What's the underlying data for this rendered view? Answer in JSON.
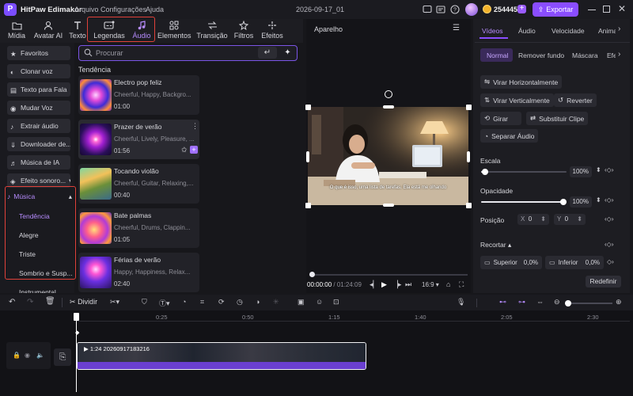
{
  "titlebar": {
    "app_name": "HitPaw Edimakor",
    "menu": [
      "Arquivo",
      "Configurações",
      "Ajuda"
    ],
    "project_name": "2026-09-17_01",
    "credits": "254445",
    "export_label": "Exportar"
  },
  "media_tabs": [
    {
      "label": "Mídia",
      "icon": "folder-icon"
    },
    {
      "label": "Avatar AI",
      "icon": "avatar-icon"
    },
    {
      "label": "Texto",
      "icon": "text-icon"
    },
    {
      "label": "Legendas",
      "icon": "captions-icon"
    },
    {
      "label": "Áudio",
      "icon": "music-note-icon",
      "active": true
    },
    {
      "label": "Elementos",
      "icon": "elements-icon"
    },
    {
      "label": "Transição",
      "icon": "transition-icon"
    },
    {
      "label": "Filtros",
      "icon": "filters-icon"
    },
    {
      "label": "Efeitos",
      "icon": "effects-icon"
    }
  ],
  "left_nav": {
    "items": [
      {
        "label": "Favoritos",
        "icon": "star-icon"
      },
      {
        "label": "Clonar voz",
        "icon": "voice-clone-icon"
      },
      {
        "label": "Texto para Fala",
        "icon": "tts-icon"
      },
      {
        "label": "Mudar Voz",
        "icon": "voice-change-icon"
      },
      {
        "label": "Extrair áudio",
        "icon": "mic-icon"
      },
      {
        "label": "Downloader de...",
        "icon": "download-icon"
      },
      {
        "label": "Música de IA",
        "icon": "ai-music-icon"
      },
      {
        "label": "Efeito sonoro...",
        "icon": "sound-effect-icon"
      }
    ],
    "music_group": {
      "label": "Música",
      "subitems": [
        "Tendência",
        "Alegre",
        "Triste",
        "Sombrio e Susp...",
        "Instrumental"
      ]
    }
  },
  "library": {
    "search_placeholder": "Procurar",
    "section_title": "Tendência",
    "tracks": [
      {
        "title": "Electro pop feliz",
        "tags": "Cheerful, Happy, Backgro...",
        "duration": "01:00"
      },
      {
        "title": "Prazer de verão",
        "tags": "Cheerful, Lively, Pleasure, ...",
        "duration": "01:56"
      },
      {
        "title": "Tocando violão",
        "tags": "Cheerful, Guitar, Relaxing,...",
        "duration": "00:40"
      },
      {
        "title": "Bate palmas",
        "tags": "Cheerful, Drums, Clappin...",
        "duration": "01:05"
      },
      {
        "title": "Férias de verão",
        "tags": "Happy, Happiness, Relax...",
        "duration": "02:40"
      }
    ]
  },
  "player": {
    "title": "Aparelho",
    "subtitle": "O que é isso, uma lista de tarefas. Ela está me olhando",
    "time_current": "00:00:00",
    "time_total": "01:24:09",
    "aspect": "16:9"
  },
  "right_panel": {
    "tabs": [
      "Vídeos",
      "Áudio",
      "Velocidade",
      "Animação"
    ],
    "subtabs": [
      "Normal",
      "Remover fundo",
      "Máscara",
      "Efeito"
    ],
    "buttons": {
      "flip_h": "Virar Horizontalmente",
      "flip_v": "Virar Verticalmente",
      "reverse": "Reverter",
      "rotate": "Girar",
      "replace": "Substituir Clipe",
      "separate_audio": "Separar Áudio"
    },
    "scale": {
      "label": "Escala",
      "value": "100%",
      "level": 0.05
    },
    "opacity": {
      "label": "Opacidade",
      "value": "100%",
      "level": 1.0
    },
    "position": {
      "label": "Posição",
      "x_label": "X",
      "x": "0",
      "y_label": "Y",
      "y": "0"
    },
    "crop": {
      "label": "Recortar",
      "top_label": "Superior",
      "top": "0,0%",
      "bottom_label": "Inferior",
      "bottom": "0,0%"
    },
    "reset_label": "Redefinir"
  },
  "timeline": {
    "split_label": "Dividir",
    "ticks": [
      "0:25",
      "0:50",
      "1:15",
      "1:40",
      "2:05",
      "2:30"
    ],
    "clip_label": "1:24 20260917183216"
  },
  "colors": {
    "accent": "#8a4dff",
    "highlight": "#e0413a",
    "clip_audio": "#6a3fd0"
  }
}
